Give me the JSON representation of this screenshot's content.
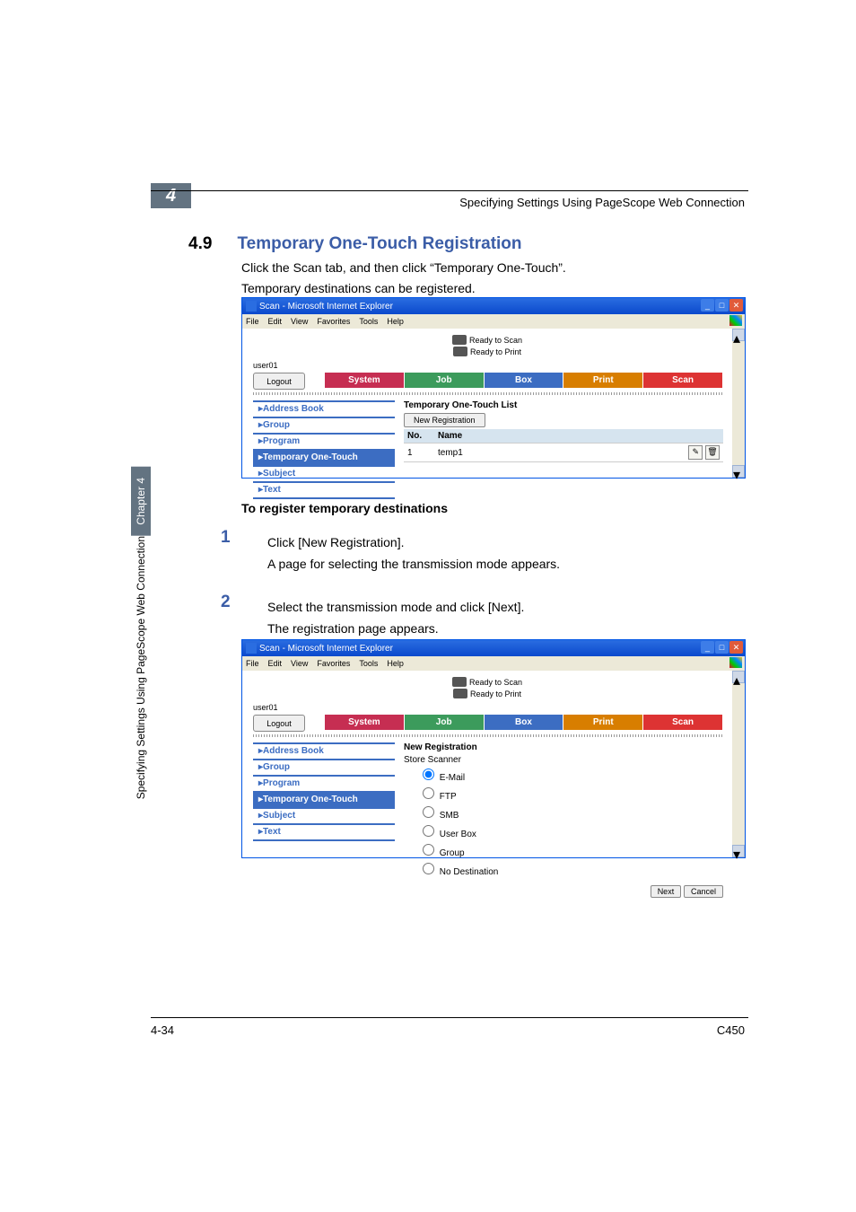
{
  "header": {
    "chapter_badge": "4",
    "running_title": "Specifying Settings Using PageScope Web Connection"
  },
  "side": {
    "chapter_label": "Chapter 4",
    "side_title": "Specifying Settings Using PageScope Web Connection"
  },
  "section": {
    "number": "4.9",
    "title": "Temporary One-Touch Registration"
  },
  "body": {
    "p1": "Click the Scan tab, and then click “Temporary One-Touch”.",
    "p2": "Temporary destinations can be registered."
  },
  "ie": {
    "title": "Scan - Microsoft Internet Explorer",
    "menu": {
      "file": "File",
      "edit": "Edit",
      "view": "View",
      "favorites": "Favorites",
      "tools": "Tools",
      "help": "Help"
    },
    "status_scan": "Ready to Scan",
    "status_print": "Ready to Print",
    "user": "user01",
    "logout": "Logout",
    "tabs": {
      "system": "System",
      "job": "Job",
      "box": "Box",
      "print": "Print",
      "scan": "Scan"
    },
    "sidemenu": {
      "address": "Address Book",
      "group": "Group",
      "program": "Program",
      "temp": "Temporary One-Touch",
      "subject": "Subject",
      "text": "Text"
    }
  },
  "screen1": {
    "pane_title": "Temporary One-Touch List",
    "new_reg": "New Registration",
    "col_no": "No.",
    "col_name": "Name",
    "row_no": "1",
    "row_name": "temp1"
  },
  "screen2": {
    "pane_title": "New Registration",
    "store_scanner": "Store Scanner",
    "opt_email": "E-Mail",
    "opt_ftp": "FTP",
    "opt_smb": "SMB",
    "opt_userbox": "User Box",
    "opt_group": "Group",
    "opt_nodest": "No Destination",
    "btn_next": "Next",
    "btn_cancel": "Cancel"
  },
  "subhead1": "To register temporary destinations",
  "steps": {
    "n1": "1",
    "t1": "Click [New Registration].",
    "t1b": "A page for selecting the transmission mode appears.",
    "n2": "2",
    "t2": "Select the transmission mode and click [Next].",
    "t2b": "The registration page appears."
  },
  "footer": {
    "left": "4-34",
    "right": "C450"
  }
}
